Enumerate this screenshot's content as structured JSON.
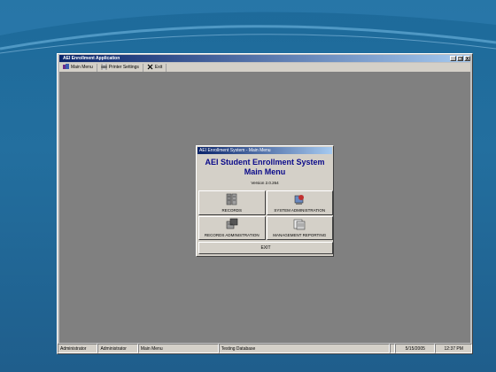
{
  "app": {
    "title": "AEI Enrollment Application",
    "controls": [
      "_",
      "❐",
      "X"
    ]
  },
  "menu": [
    {
      "label": "Main Menu",
      "icon": "main-menu-icon"
    },
    {
      "label": "Printer Settings",
      "icon": "printer-icon"
    },
    {
      "label": "Exit",
      "icon": "exit-icon"
    }
  ],
  "dialog": {
    "title": "AEI Enrollment System - Main Menu",
    "heading": "AEI Student Enrollment System",
    "subheading": "Main Menu",
    "version": "Version 2.0.264",
    "tiles": [
      {
        "label": "RECORDS",
        "icon": "records-icon"
      },
      {
        "label": "SYSTEM ADMINISTRATION",
        "icon": "system-admin-icon"
      },
      {
        "label": "RECORDS ADMINISTRATION",
        "icon": "records-admin-icon"
      },
      {
        "label": "MANAGEMENT REPORTING",
        "icon": "reporting-icon"
      }
    ],
    "exit_label": "EXIT"
  },
  "status": {
    "cells": [
      "Administrator",
      "Administrator",
      "Main Menu",
      "Testing Database",
      "",
      "5/15/2005",
      "12:37 PM"
    ]
  }
}
